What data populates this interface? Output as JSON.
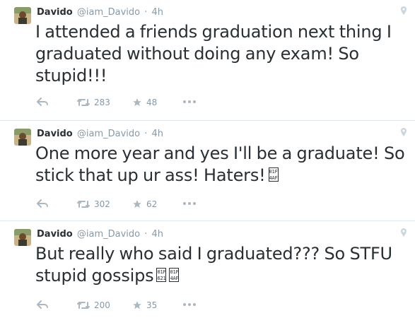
{
  "tweets": [
    {
      "name": "Davido",
      "handle": "@iam_Davido",
      "time": "4h",
      "text": "I attended a friends graduation next thing I graduated without doing any exam! So stupid!!!",
      "emojis": [],
      "retweets": "283",
      "favorites": "48"
    },
    {
      "name": "Davido",
      "handle": "@iam_Davido",
      "time": "4h",
      "text": "One more year and yes I'll be a graduate! So stick that up ur ass! Haters!",
      "emojis": [
        "01F\n4AF"
      ],
      "retweets": "302",
      "favorites": "62"
    },
    {
      "name": "Davido",
      "handle": "@iam_Davido",
      "time": "4h",
      "text": "But really who said I graduated??? So STFU stupid gossips",
      "emojis": [
        "01F\n621",
        "01F\n4AF"
      ],
      "retweets": "200",
      "favorites": "35"
    }
  ],
  "separator": "·",
  "icons": {
    "reply": "reply-icon",
    "retweet": "retweet-icon",
    "favorite": "star-icon",
    "more": "more-icon",
    "geo": "location-pin-icon"
  },
  "colors": {
    "text": "#292f33",
    "muted": "#8899a6",
    "icon": "#aab8c2",
    "divider": "#e1e8ed"
  }
}
